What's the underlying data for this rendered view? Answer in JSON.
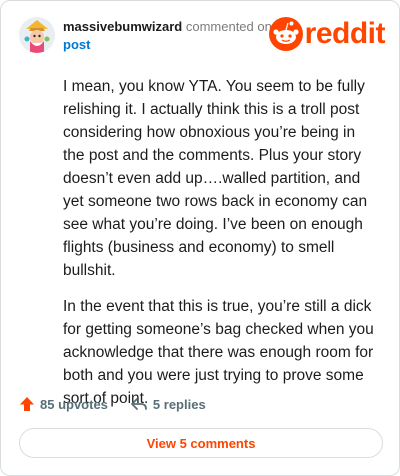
{
  "comment": {
    "username": "massivebumwizard",
    "action_text": "commented on",
    "post_link": "post",
    "paragraphs": [
      "I mean, you know YTA. You seem to be fully relishing it. I actually think this is a troll post considering how obnoxious you’re being in the post and the comments. Plus your story doesn’t even add up….walled partition, and yet someone two rows back in economy can see what you’re doing. I’ve been on enough flights (business and economy) to smell bullshit.",
      "In the event that this is true, you’re still a dick for getting someone’s bag checked when you acknowledge that there was enough room for both and you were just trying to prove some sort of point."
    ]
  },
  "brand": {
    "logo_text": "reddit",
    "color": "#ff4500"
  },
  "footer": {
    "upvotes": "85 upvotes",
    "replies": "5 replies"
  },
  "actions": {
    "view_comments": "View 5 comments"
  },
  "colors": {
    "accent": "#ff4500",
    "link": "#0079d3",
    "muted": "#576f76"
  }
}
